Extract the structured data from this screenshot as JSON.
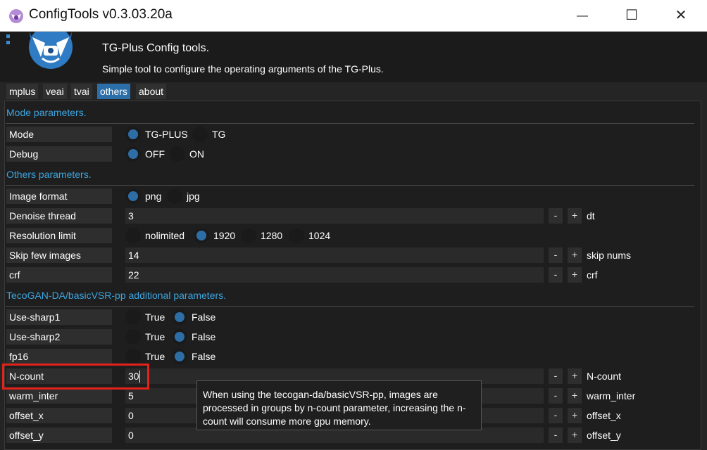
{
  "window": {
    "title": "ConfigTools v0.3.03.20a",
    "minimize": "—",
    "maximize": "☐",
    "close": "✕"
  },
  "header": {
    "title": "TG-Plus Config tools.",
    "description": "Simple tool to configure the operating arguments of the TG-Plus."
  },
  "tabs": [
    "mplus",
    "veai",
    "tvai",
    "others",
    "about"
  ],
  "active_tab": "others",
  "sections": {
    "mode": "Mode parameters.",
    "others": "Others parameters.",
    "tecogan": "TecoGAN-DA/basicVSR-pp additional parameters."
  },
  "rows": {
    "mode": {
      "label": "Mode",
      "options": [
        "TG-PLUS",
        "TG"
      ],
      "selected": "TG-PLUS"
    },
    "debug": {
      "label": "Debug",
      "options": [
        "OFF",
        "ON"
      ],
      "selected": "OFF"
    },
    "image_format": {
      "label": "Image format",
      "options": [
        "png",
        "jpg"
      ],
      "selected": "png"
    },
    "denoise_thread": {
      "label": "Denoise thread",
      "value": "3",
      "unit": "dt"
    },
    "resolution_limit": {
      "label": "Resolution limit",
      "options": [
        "nolimited",
        "1920",
        "1280",
        "1024"
      ],
      "selected": "1920"
    },
    "skip_few_images": {
      "label": "Skip few images",
      "value": "14",
      "unit": "skip nums"
    },
    "crf": {
      "label": "crf",
      "value": "22",
      "unit": "crf"
    },
    "use_sharp1": {
      "label": "Use-sharp1",
      "options": [
        "True",
        "False"
      ],
      "selected": "False"
    },
    "use_sharp2": {
      "label": "Use-sharp2",
      "options": [
        "True",
        "False"
      ],
      "selected": "False"
    },
    "fp16": {
      "label": "fp16",
      "options": [
        "True",
        "False"
      ],
      "selected": "False"
    },
    "n_count": {
      "label": "N-count",
      "value": "30",
      "unit": "N-count"
    },
    "warm_inter": {
      "label": "warm_inter",
      "value": "5",
      "unit": "warm_inter"
    },
    "offset_x": {
      "label": "offset_x",
      "value": "0",
      "unit": "offset_x"
    },
    "offset_y": {
      "label": "offset_y",
      "value": "0",
      "unit": "offset_y"
    }
  },
  "stepper": {
    "minus": "-",
    "plus": "+"
  },
  "tooltip": "When using the tecogan-da/basicVSR-pp, images are processed in groups by n-count parameter, increasing the n-count will consume more gpu memory.",
  "colors": {
    "accent": "#3da5e0",
    "radio_on": "#2d6ea6",
    "highlight": "#e2231a",
    "tab_active": "#2c6fa8"
  }
}
